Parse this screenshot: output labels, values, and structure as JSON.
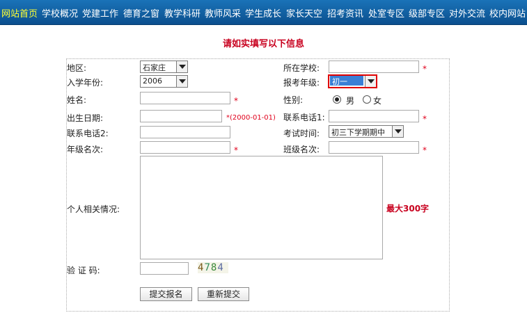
{
  "nav": {
    "items": [
      "网站首页",
      "学校概况",
      "党建工作",
      "德育之窗",
      "教学科研",
      "教师风采",
      "学生成长",
      "家长天空",
      "招考资讯",
      "处室专区",
      "级部专区",
      "对外交流",
      "校内网站"
    ],
    "active_index": 0
  },
  "page_title": "请如实填写以下信息",
  "form": {
    "region_label": "地区:",
    "region_value": "石家庄",
    "school_label": "所在学校:",
    "school_value": "",
    "entry_year_label": "入学年份:",
    "entry_year_value": "2006",
    "grade_label": "报考年级:",
    "grade_value": "初一",
    "name_label": "姓名:",
    "name_value": "",
    "gender_label": "性别:",
    "gender_options": [
      "男",
      "女"
    ],
    "gender_selected": "男",
    "birth_label": "出生日期:",
    "birth_value": "",
    "birth_hint": "*(2000-01-01)",
    "phone1_label": "联系电话1:",
    "phone1_value": "",
    "phone2_label": "联系电话2:",
    "phone2_value": "",
    "exam_time_label": "考试时间:",
    "exam_time_value": "初三下学期期中",
    "grade_rank_label": "年级名次:",
    "grade_rank_value": "",
    "class_rank_label": "班级名次:",
    "class_rank_value": "",
    "personal_label": "个人相关情况:",
    "personal_value": "",
    "max_hint": "最大300字",
    "captcha_label": "验 证 码:",
    "captcha_value": "",
    "captcha_code": [
      "4",
      "7",
      "8",
      "4"
    ],
    "captcha_colors": [
      "#7a5a1a",
      "#2e8b57",
      "#3a8a3a",
      "#5a6aa0"
    ],
    "required_mark": "*",
    "submit_label": "提交报名",
    "reset_label": "重新提交"
  },
  "colors": {
    "nav_bg": "#0b5a9c",
    "nav_active": "#ffff33",
    "title_red": "#c8001e",
    "required_red": "#e0001b",
    "focus_border": "#e00000",
    "select_highlight": "#3a7fd5"
  }
}
